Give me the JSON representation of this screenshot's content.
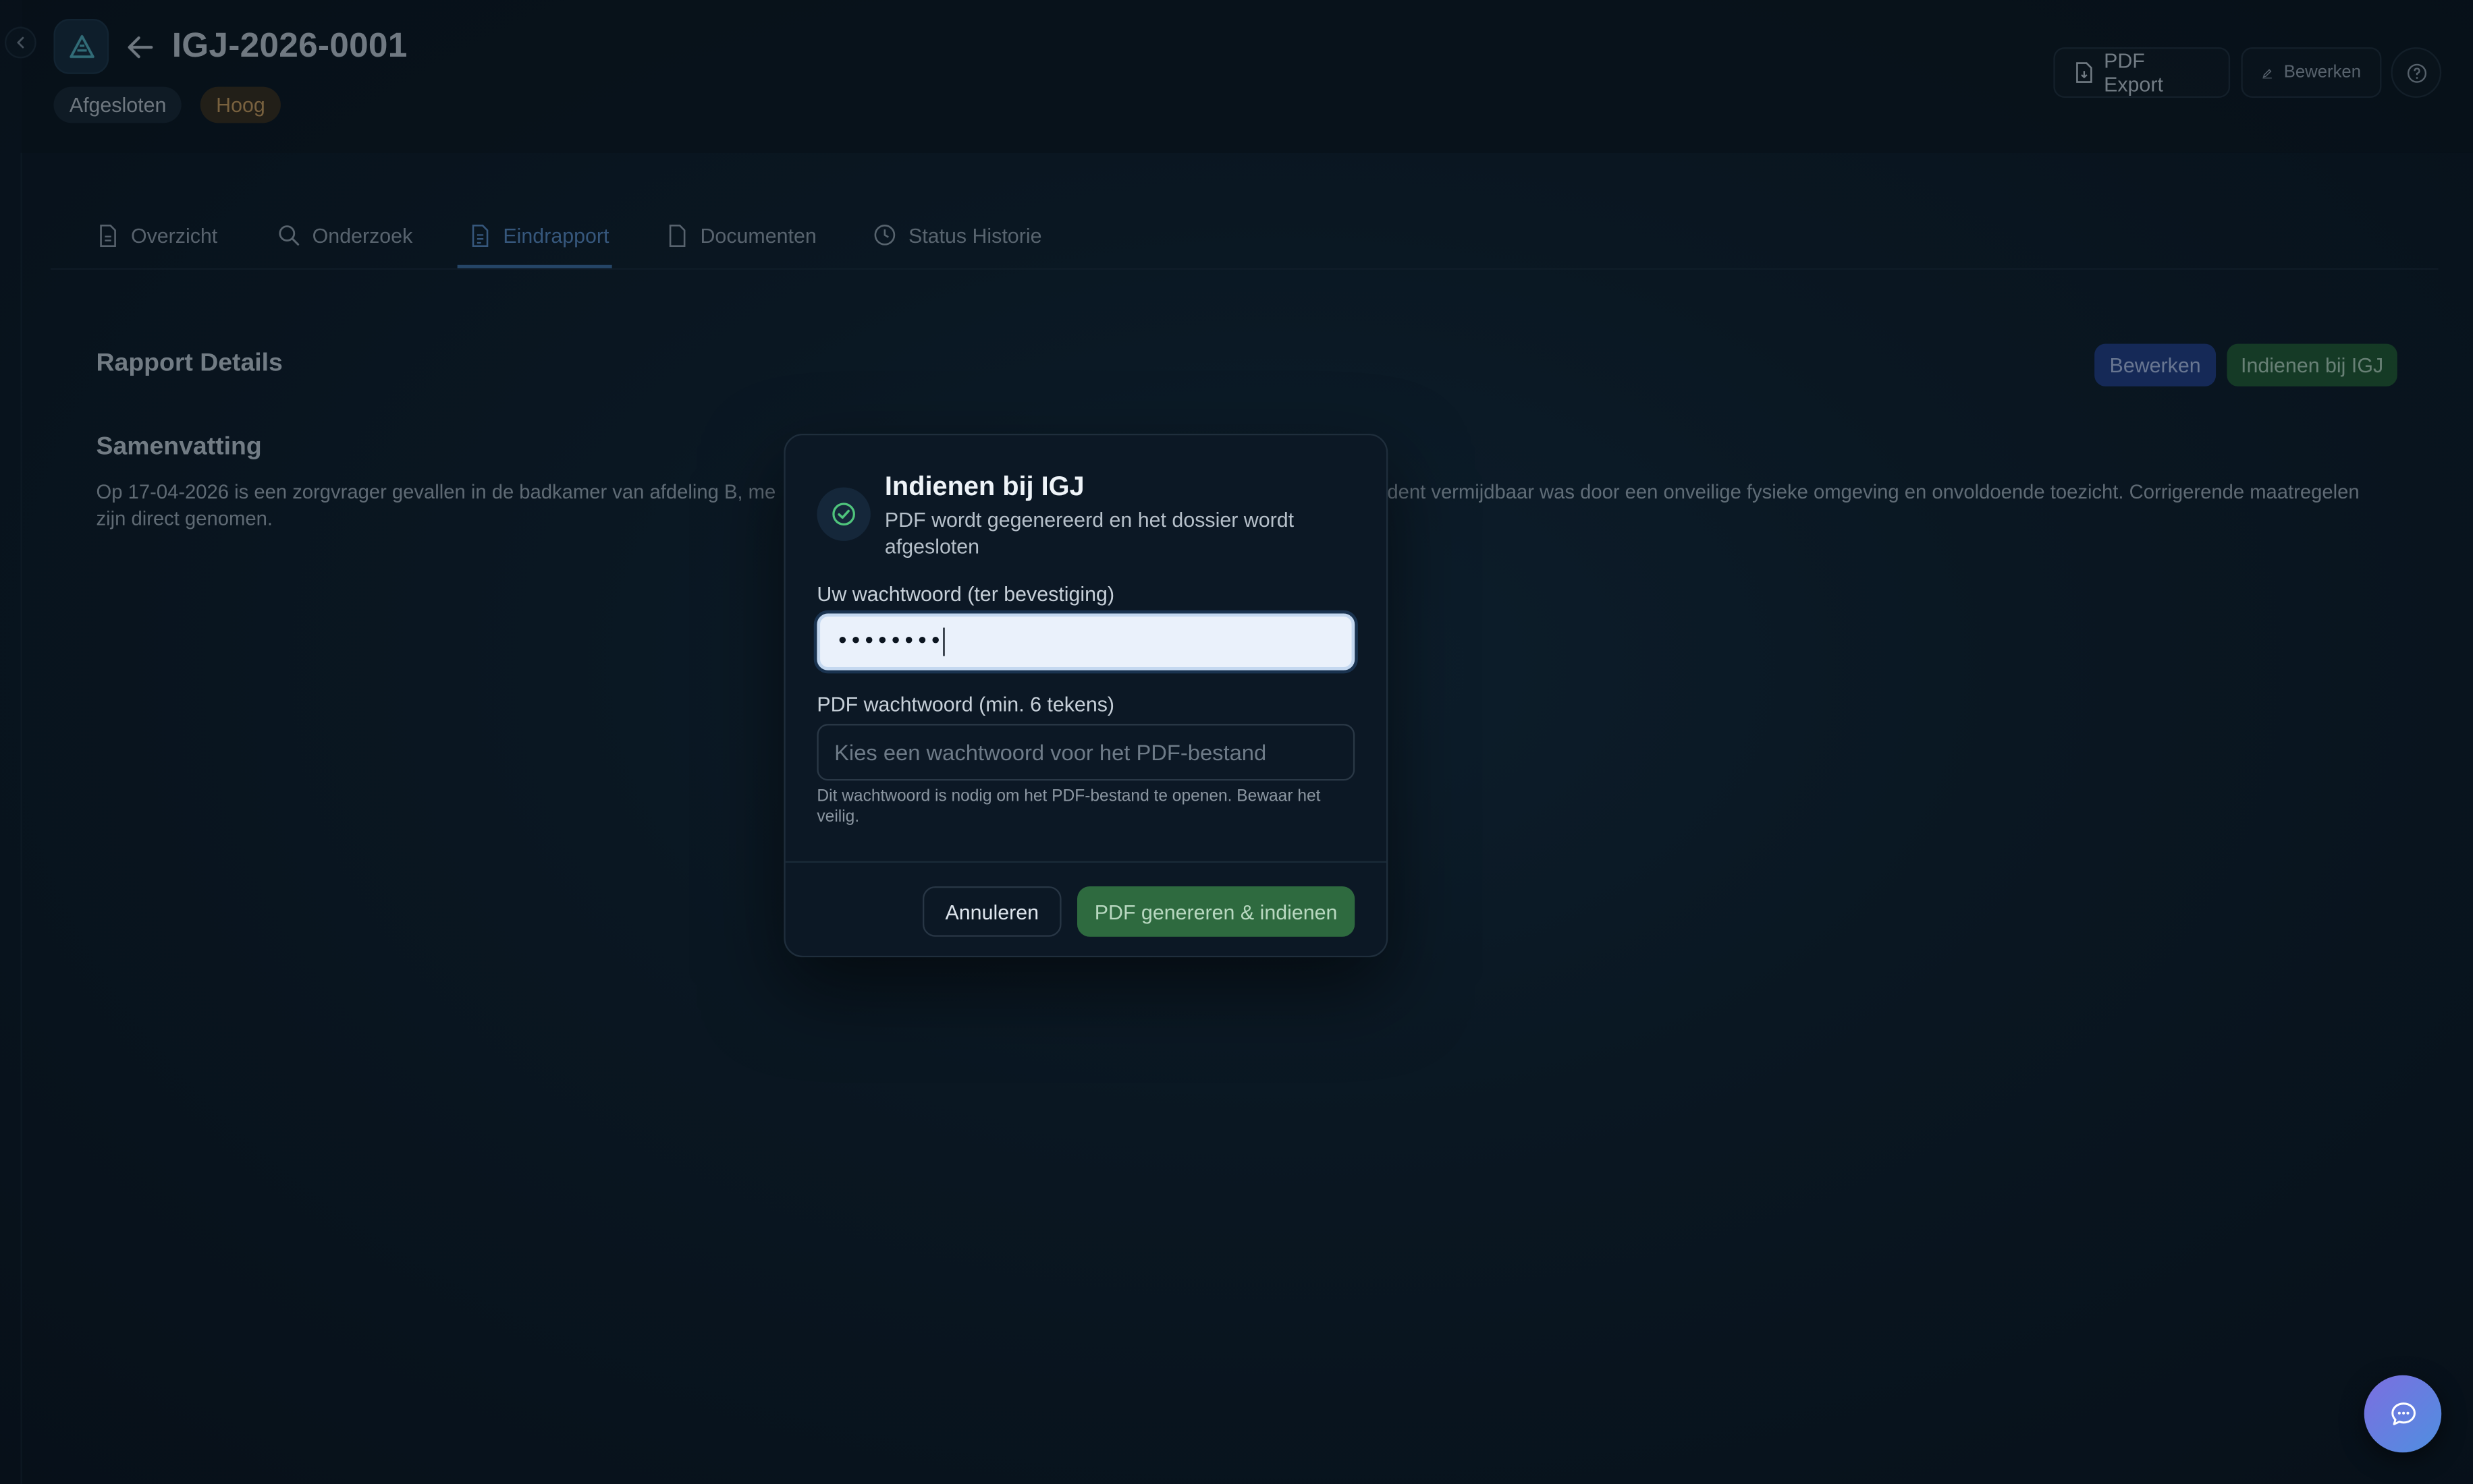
{
  "header": {
    "case_id": "IGJ-2026-0001",
    "status_badge": "Afgesloten",
    "priority_badge": "Hoog",
    "pdf_export_label": "PDF Export",
    "edit_label": "Bewerken"
  },
  "tabs": [
    {
      "label": "Overzicht",
      "icon": "file-icon",
      "active": false
    },
    {
      "label": "Onderzoek",
      "icon": "search-icon",
      "active": false
    },
    {
      "label": "Eindrapport",
      "icon": "file-text-icon",
      "active": true
    },
    {
      "label": "Documenten",
      "icon": "document-icon",
      "active": false
    },
    {
      "label": "Status Historie",
      "icon": "clock-icon",
      "active": false
    }
  ],
  "report": {
    "title": "Rapport Details",
    "edit_button": "Bewerken",
    "submit_button": "Indienen bij IGJ",
    "summary_title": "Samenvatting",
    "summary_text_before": "Op 17-04-2026 is een zorgvrager gevallen in de badkamer van afdeling B, me",
    "summary_text_after": "ident vermijdbaar was door een onveilige fysieke omgeving en onvoldoende toezicht. Corrigerende maatregelen",
    "summary_text_line2": "zijn direct genomen."
  },
  "modal": {
    "title": "Indienen bij IGJ",
    "subtitle": "PDF wordt gegenereerd en het dossier wordt afgesloten",
    "password_label": "Uw wachtwoord (ter bevestiging)",
    "password_value": "••••••••",
    "pdf_password_label": "PDF wachtwoord (min. 6 tekens)",
    "pdf_password_placeholder": "Kies een wachtwoord voor het PDF-bestand",
    "hint": "Dit wachtwoord is nodig om het PDF-bestand te openen. Bewaar het veilig.",
    "cancel_label": "Annuleren",
    "submit_label": "PDF genereren & indienen"
  },
  "colors": {
    "accent_blue": "#3d6da3",
    "green_button": "#2e6a3f",
    "priority_badge": "#d5a35c"
  }
}
